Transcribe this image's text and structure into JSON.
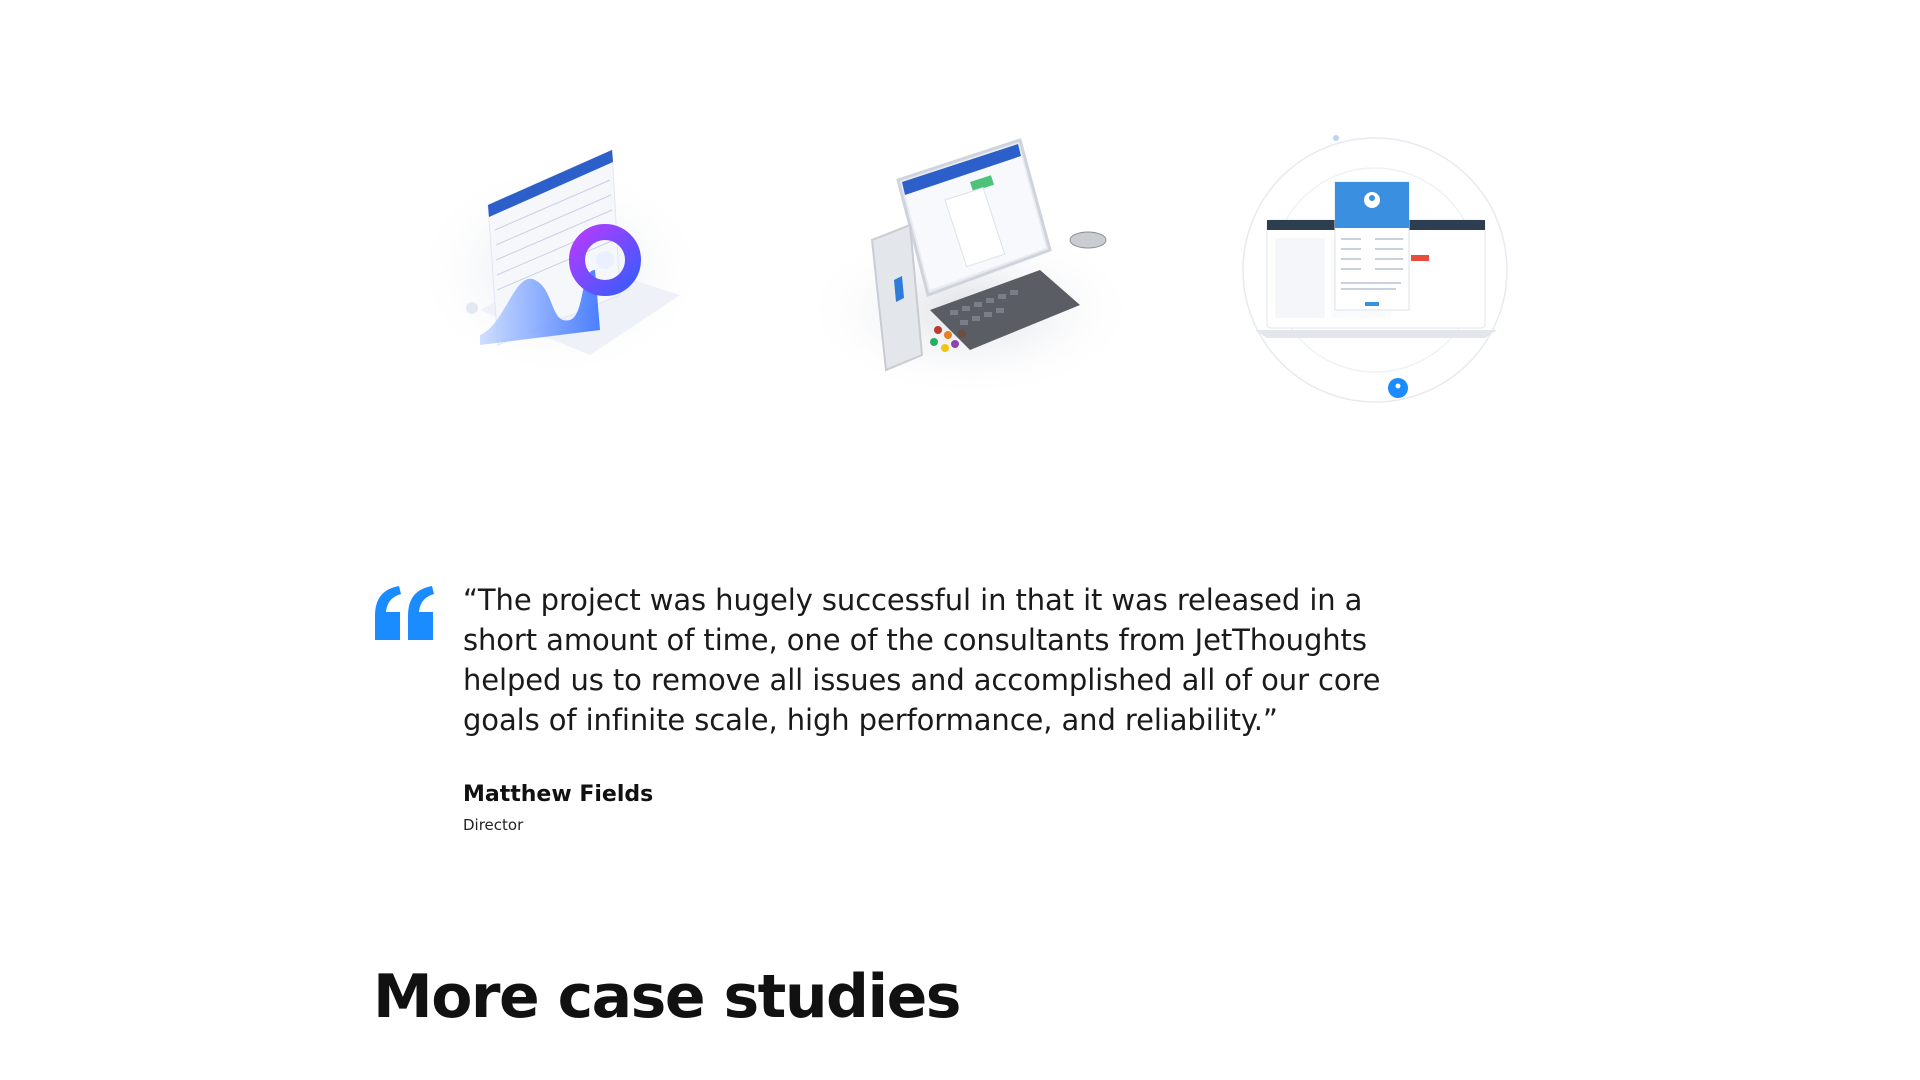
{
  "illustrations": [
    {
      "icon": "analytics-dashboard-illustration"
    },
    {
      "icon": "tablet-phone-devices-illustration"
    },
    {
      "icon": "profile-app-laptop-illustration"
    }
  ],
  "testimonial": {
    "quote_icon": "quote-mark-icon",
    "text": "“The project was hugely successful in that it was released in a short amount of time, one of the consultants from JetThoughts helped us to remove all issues and accomplished all of our core goals of infinite scale, high performance, and reliability.”",
    "author": "Matthew Fields",
    "role": "Director"
  },
  "more_section": {
    "title": "More case studies"
  },
  "colors": {
    "accent": "#1a8cff",
    "text": "#1a1a1a"
  }
}
